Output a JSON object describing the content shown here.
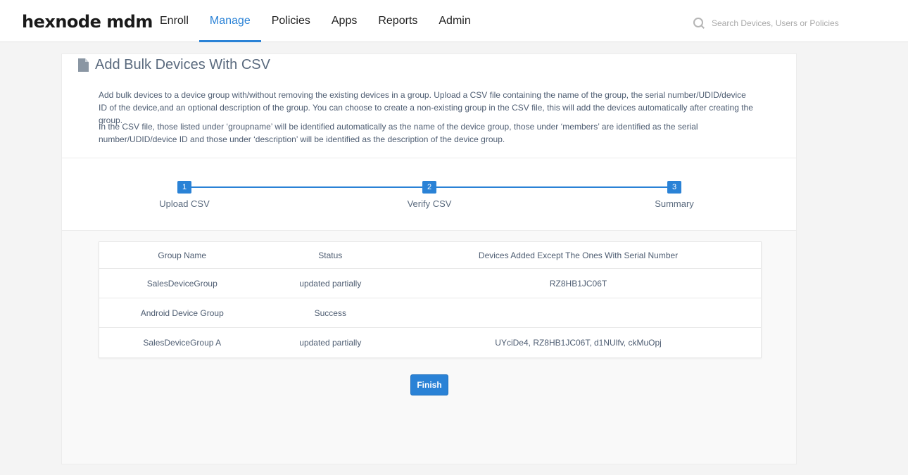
{
  "brand": {
    "logo_text": "hexnode mdm"
  },
  "nav": {
    "items": [
      {
        "label": "Enroll",
        "active": false
      },
      {
        "label": "Manage",
        "active": true
      },
      {
        "label": "Policies",
        "active": false
      },
      {
        "label": "Apps",
        "active": false
      },
      {
        "label": "Reports",
        "active": false
      },
      {
        "label": "Admin",
        "active": false
      }
    ]
  },
  "search": {
    "placeholder": "Search Devices, Users or Policies",
    "icon": "search-icon"
  },
  "page": {
    "title": "Add Bulk Devices With CSV",
    "title_icon": "document-icon",
    "description_1": "Add bulk devices to a device group with/without removing the existing devices in a group. Upload a CSV file containing the name of the group, the serial number/UDID/device ID of the device,and an optional description of the group. You can choose to create a non-existing group in the CSV file, this will add the devices automatically after creating the group.",
    "description_2": "In the CSV file, those listed under ‘groupname’ will be identified automatically as the name of the device group, those under ‘members’ are identified as the serial number/UDID/device ID and those under ‘description’ will be identified as the description of the device group."
  },
  "stepper": {
    "steps": [
      {
        "number": "1",
        "label": "Upload CSV"
      },
      {
        "number": "2",
        "label": "Verify CSV"
      },
      {
        "number": "3",
        "label": "Summary"
      }
    ]
  },
  "table": {
    "columns": [
      "Group Name",
      "Status",
      "Devices Added Except The Ones With Serial Number"
    ],
    "rows": [
      [
        "SalesDeviceGroup",
        "updated partially",
        "RZ8HB1JC06T"
      ],
      [
        "Android Device Group",
        "Success",
        ""
      ],
      [
        "SalesDeviceGroup A",
        "updated partially",
        "UYciDe4, RZ8HB1JC06T, d1NUlfv, ckMuOpj"
      ]
    ]
  },
  "actions": {
    "finish_label": "Finish"
  },
  "colors": {
    "accent": "#2a82d6",
    "text_muted": "#4e5d72",
    "background": "#f4f4f4"
  }
}
